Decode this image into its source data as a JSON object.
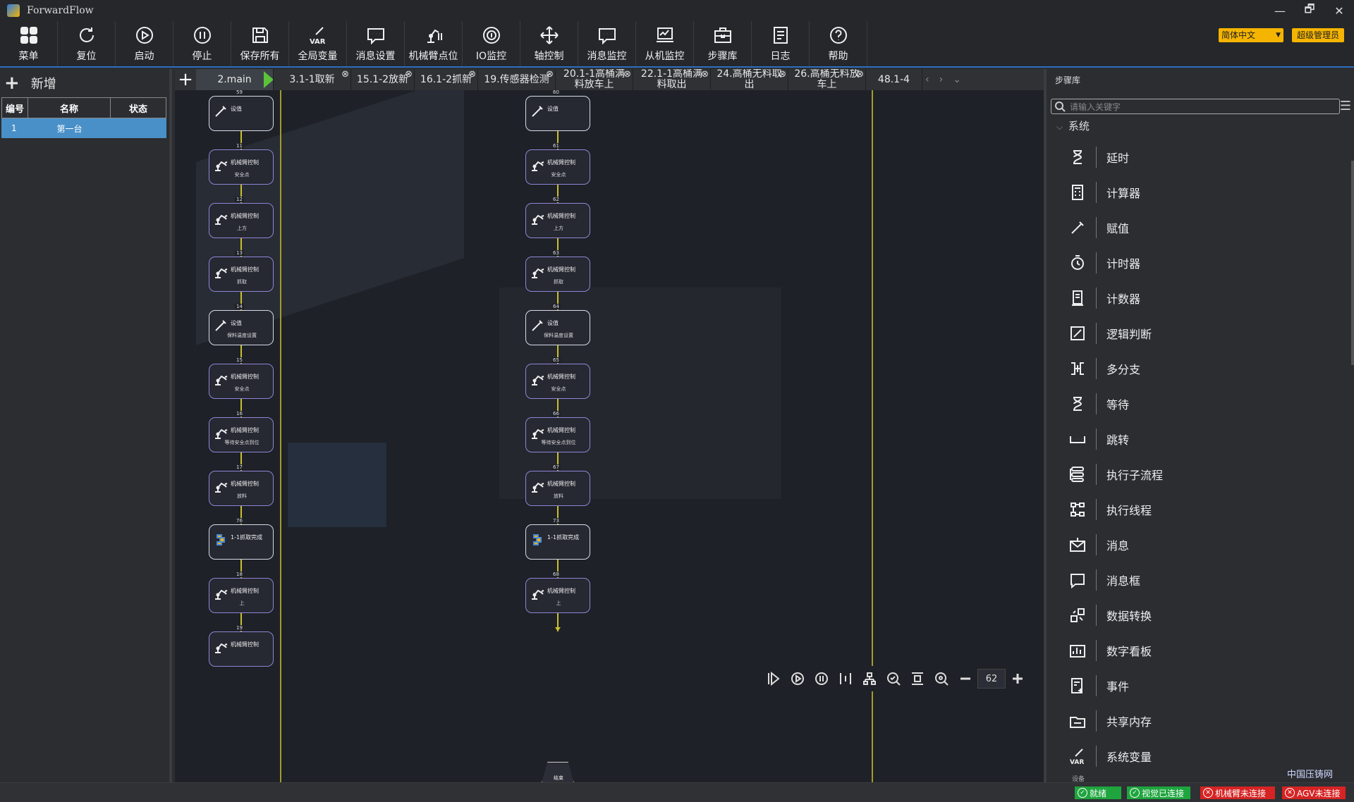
{
  "app": {
    "title": "ForwardFlow"
  },
  "window_controls": [
    "—",
    "🗗",
    "✕"
  ],
  "toolbar": [
    {
      "label": "菜单",
      "icon": "grid-icon"
    },
    {
      "label": "复位",
      "icon": "reset-icon"
    },
    {
      "label": "启动",
      "icon": "start-icon"
    },
    {
      "label": "停止",
      "icon": "stop-icon"
    },
    {
      "label": "保存所有",
      "icon": "save-icon"
    },
    {
      "label": "全局变量",
      "icon": "var-icon"
    },
    {
      "label": "消息设置",
      "icon": "message-icon"
    },
    {
      "label": "机械臂点位",
      "icon": "robot-arm-icon"
    },
    {
      "label": "IO监控",
      "icon": "io-icon"
    },
    {
      "label": "轴控制",
      "icon": "axis-icon"
    },
    {
      "label": "消息监控",
      "icon": "message-monitor-icon"
    },
    {
      "label": "从机监控",
      "icon": "slave-monitor-icon"
    },
    {
      "label": "步骤库",
      "icon": "toolbox-icon"
    },
    {
      "label": "日志",
      "icon": "log-icon"
    },
    {
      "label": "帮助",
      "icon": "help-icon"
    }
  ],
  "var_label": "VAR",
  "language": "简体中文",
  "user_role": "超级管理员",
  "left_panel": {
    "add_label": "新增",
    "headers": [
      "编号",
      "名称",
      "状态"
    ],
    "rows": [
      {
        "id": "1",
        "name": "第一台",
        "status": ""
      }
    ]
  },
  "tabs": [
    {
      "label": "2.main",
      "active": true,
      "closable": false
    },
    {
      "label": "3.1-1取新",
      "closable": true
    },
    {
      "label": "15.1-2放新",
      "closable": true
    },
    {
      "label": "16.1-2抓新",
      "closable": true
    },
    {
      "label": "19.传感器检测",
      "closable": true
    },
    {
      "label": "20.1-1高桶满\n料放车上",
      "closable": true
    },
    {
      "label": "22.1-1高桶满\n料取出",
      "closable": true
    },
    {
      "label": "24.高桶无料取\n出",
      "closable": true
    },
    {
      "label": "26.高桶无料放\n车上",
      "closable": true
    },
    {
      "label": "48.1-4",
      "closable": false
    }
  ],
  "flow_left": [
    {
      "id": "59",
      "type": "set",
      "title": "设值",
      "sub": ""
    },
    {
      "id": "11",
      "type": "robot",
      "title": "机械臂控制",
      "sub": "安全点"
    },
    {
      "id": "12",
      "type": "robot",
      "title": "机械臂控制",
      "sub": "上方"
    },
    {
      "id": "13",
      "type": "robot",
      "title": "机械臂控制",
      "sub": "抓取"
    },
    {
      "id": "14",
      "type": "set",
      "title": "设值",
      "sub": "保料温度设置"
    },
    {
      "id": "15",
      "type": "robot",
      "title": "机械臂控制",
      "sub": "安全点"
    },
    {
      "id": "16",
      "type": "robot",
      "title": "机械臂控制",
      "sub": "等待安全点到位"
    },
    {
      "id": "17",
      "type": "robot",
      "title": "机械臂控制",
      "sub": "放料"
    },
    {
      "id": "76",
      "type": "sub",
      "title": "1-1抓取完成",
      "sub": ""
    },
    {
      "id": "18",
      "type": "robot",
      "title": "机械臂控制",
      "sub": "上"
    },
    {
      "id": "19",
      "type": "robot",
      "title": "机械臂控制",
      "sub": ""
    }
  ],
  "flow_right": [
    {
      "id": "60",
      "type": "set",
      "title": "设值",
      "sub": ""
    },
    {
      "id": "61",
      "type": "robot",
      "title": "机械臂控制",
      "sub": "安全点"
    },
    {
      "id": "62",
      "type": "robot",
      "title": "机械臂控制",
      "sub": "上方"
    },
    {
      "id": "63",
      "type": "robot",
      "title": "机械臂控制",
      "sub": "抓取"
    },
    {
      "id": "64",
      "type": "set",
      "title": "设值",
      "sub": "保料温度设置"
    },
    {
      "id": "65",
      "type": "robot",
      "title": "机械臂控制",
      "sub": "安全点"
    },
    {
      "id": "66",
      "type": "robot",
      "title": "机械臂控制",
      "sub": "等待安全点到位"
    },
    {
      "id": "67",
      "type": "robot",
      "title": "机械臂控制",
      "sub": "放料"
    },
    {
      "id": "73",
      "type": "sub",
      "title": "1-1抓取完成",
      "sub": ""
    },
    {
      "id": "68",
      "type": "robot",
      "title": "机械臂控制",
      "sub": "上"
    }
  ],
  "flow_end": {
    "id": "58",
    "label": "结束"
  },
  "zoom": "62",
  "right_panel": {
    "title": "步骤库",
    "search_placeholder": "请输入关键字",
    "group": "系统",
    "items": [
      {
        "name": "延时",
        "icon": "hourglass-icon"
      },
      {
        "name": "计算器",
        "icon": "calculator-icon"
      },
      {
        "name": "赋值",
        "icon": "assign-icon"
      },
      {
        "name": "计时器",
        "icon": "timer-icon"
      },
      {
        "name": "计数器",
        "icon": "counter-icon"
      },
      {
        "name": "逻辑判断",
        "icon": "logic-icon"
      },
      {
        "name": "多分支",
        "icon": "branch-icon"
      },
      {
        "name": "等待",
        "icon": "wait-icon"
      },
      {
        "name": "跳转",
        "icon": "jump-icon"
      },
      {
        "name": "执行子流程",
        "icon": "subflow-icon"
      },
      {
        "name": "执行线程",
        "icon": "thread-icon"
      },
      {
        "name": "消息",
        "icon": "mail-icon"
      },
      {
        "name": "消息框",
        "icon": "messagebox-icon"
      },
      {
        "name": "数据转换",
        "icon": "convert-icon"
      },
      {
        "name": "数字看板",
        "icon": "dashboard-icon"
      },
      {
        "name": "事件",
        "icon": "event-icon"
      },
      {
        "name": "共享内存",
        "icon": "shared-memory-icon"
      },
      {
        "name": "系统变量",
        "icon": "system-var-icon"
      }
    ],
    "more": "设备"
  },
  "status": [
    {
      "label": "就绪",
      "kind": "ok"
    },
    {
      "label": "视觉已连接",
      "kind": "ok"
    },
    {
      "label": "机械臂未连接",
      "kind": "err"
    },
    {
      "label": "AGV未连接",
      "kind": "err"
    }
  ],
  "watermark": "中国压铸网"
}
